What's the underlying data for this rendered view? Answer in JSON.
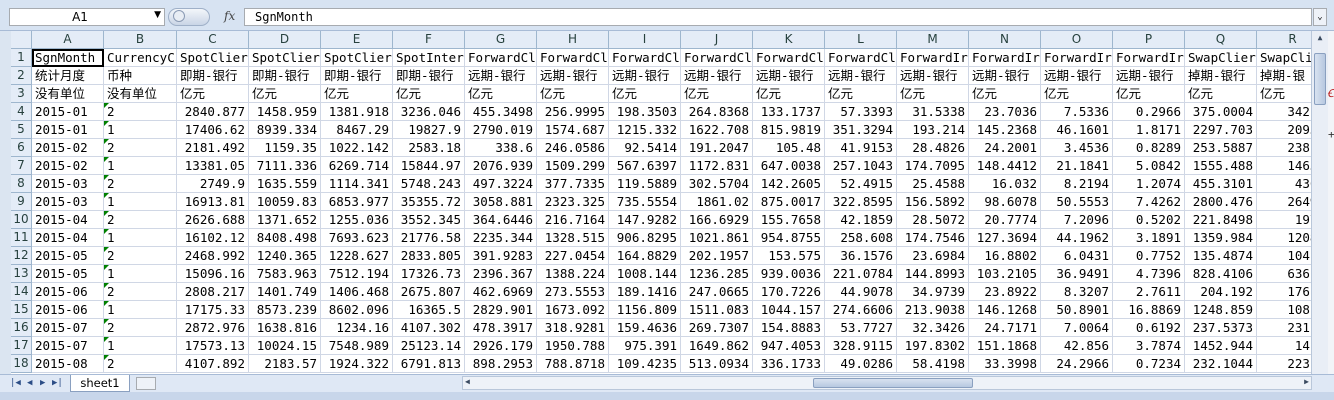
{
  "formula_bar": {
    "name_box": "A1",
    "fx_label": "fx",
    "formula": "SgnMonth"
  },
  "sheet": {
    "columns": [
      "A",
      "B",
      "C",
      "D",
      "E",
      "F",
      "G",
      "H",
      "I",
      "J",
      "K",
      "L",
      "M",
      "N",
      "O",
      "P",
      "Q",
      "R"
    ],
    "rows": [
      {
        "n": "1",
        "cells": [
          "SgnMonth",
          "CurrencyC",
          "SpotClier",
          "SpotClier",
          "SpotClier",
          "SpotInter",
          "ForwardCl",
          "ForwardCl",
          "ForwardCl",
          "ForwardCl",
          "ForwardCl",
          "ForwardCl",
          "ForwardIr",
          "ForwardIr",
          "ForwardIr",
          "ForwardIr",
          "SwapClier",
          "SwapCli"
        ]
      },
      {
        "n": "2",
        "cells": [
          "统计月度",
          "币种",
          "即期-银行",
          "即期-银行",
          "即期-银行",
          "即期-银行",
          "远期-银行",
          "远期-银行",
          "远期-银行",
          "远期-银行",
          "远期-银行",
          "远期-银行",
          "远期-银行",
          "远期-银行",
          "远期-银行",
          "远期-银行",
          "掉期-银行",
          "掉期-银"
        ]
      },
      {
        "n": "3",
        "cells": [
          "没有单位",
          "没有单位",
          "亿元",
          "亿元",
          "亿元",
          "亿元",
          "亿元",
          "亿元",
          "亿元",
          "亿元",
          "亿元",
          "亿元",
          "亿元",
          "亿元",
          "亿元",
          "亿元",
          "亿元",
          "亿元"
        ]
      },
      {
        "n": "4",
        "cells": [
          "2015-01",
          "2",
          "2840.877",
          "1458.959",
          "1381.918",
          "3236.046",
          "455.3498",
          "256.9995",
          "198.3503",
          "264.8368",
          "133.1737",
          "57.3393",
          "31.5338",
          "23.7036",
          "7.5336",
          "0.2966",
          "375.0004",
          "342.0"
        ]
      },
      {
        "n": "5",
        "cells": [
          "2015-01",
          "1",
          "17406.62",
          "8939.334",
          "8467.29",
          "19827.9",
          "2790.019",
          "1574.687",
          "1215.332",
          "1622.708",
          "815.9819",
          "351.3294",
          "193.214",
          "145.2368",
          "46.1601",
          "1.8171",
          "2297.703",
          "2095."
        ]
      },
      {
        "n": "6",
        "cells": [
          "2015-02",
          "2",
          "2181.492",
          "1159.35",
          "1022.142",
          "2583.18",
          "338.6",
          "246.0586",
          "92.5414",
          "191.2047",
          "105.48",
          "41.9153",
          "28.4826",
          "24.2001",
          "3.4536",
          "0.8289",
          "253.5887",
          "238.8"
        ]
      },
      {
        "n": "7",
        "cells": [
          "2015-02",
          "1",
          "13381.05",
          "7111.336",
          "6269.714",
          "15844.97",
          "2076.939",
          "1509.299",
          "567.6397",
          "1172.831",
          "647.0038",
          "257.1043",
          "174.7095",
          "148.4412",
          "21.1841",
          "5.0842",
          "1555.488",
          "1465."
        ]
      },
      {
        "n": "8",
        "cells": [
          "2015-03",
          "2",
          "2749.9",
          "1635.559",
          "1114.341",
          "5748.243",
          "497.3224",
          "377.7335",
          "119.5889",
          "302.5704",
          "142.2605",
          "52.4915",
          "25.4588",
          "16.032",
          "8.2194",
          "1.2074",
          "455.3101",
          "430."
        ]
      },
      {
        "n": "9",
        "cells": [
          "2015-03",
          "1",
          "16913.81",
          "10059.83",
          "6853.977",
          "35355.72",
          "3058.881",
          "2323.325",
          "735.5554",
          "1861.02",
          "875.0017",
          "322.8595",
          "156.5892",
          "98.6078",
          "50.5553",
          "7.4262",
          "2800.476",
          "2649."
        ]
      },
      {
        "n": "10",
        "cells": [
          "2015-04",
          "2",
          "2626.688",
          "1371.652",
          "1255.036",
          "3552.345",
          "364.6446",
          "216.7164",
          "147.9282",
          "166.6929",
          "155.7658",
          "42.1859",
          "28.5072",
          "20.7774",
          "7.2096",
          "0.5202",
          "221.8498",
          "197."
        ]
      },
      {
        "n": "11",
        "cells": [
          "2015-04",
          "1",
          "16102.12",
          "8408.498",
          "7693.623",
          "21776.58",
          "2235.344",
          "1328.515",
          "906.8295",
          "1021.861",
          "954.8755",
          "258.608",
          "174.7546",
          "127.3694",
          "44.1962",
          "3.1891",
          "1359.984",
          "1208."
        ]
      },
      {
        "n": "12",
        "cells": [
          "2015-05",
          "2",
          "2468.992",
          "1240.365",
          "1228.627",
          "2833.805",
          "391.9283",
          "227.0454",
          "164.8829",
          "202.1957",
          "153.575",
          "36.1576",
          "23.6984",
          "16.8802",
          "6.0431",
          "0.7752",
          "135.4874",
          "104.0"
        ]
      },
      {
        "n": "13",
        "cells": [
          "2015-05",
          "1",
          "15096.16",
          "7583.963",
          "7512.194",
          "17326.73",
          "2396.367",
          "1388.224",
          "1008.144",
          "1236.285",
          "939.0036",
          "221.0784",
          "144.8993",
          "103.2105",
          "36.9491",
          "4.7396",
          "828.4106",
          "636.1"
        ]
      },
      {
        "n": "14",
        "cells": [
          "2015-06",
          "2",
          "2808.217",
          "1401.749",
          "1406.468",
          "2675.807",
          "462.6969",
          "273.5553",
          "189.1416",
          "247.0665",
          "170.7226",
          "44.9078",
          "34.9739",
          "23.8922",
          "8.3207",
          "2.7611",
          "204.192",
          "176.8"
        ]
      },
      {
        "n": "15",
        "cells": [
          "2015-06",
          "1",
          "17175.33",
          "8573.239",
          "8602.096",
          "16365.5",
          "2829.901",
          "1673.092",
          "1156.809",
          "1511.083",
          "1044.157",
          "274.6606",
          "213.9038",
          "146.1268",
          "50.8901",
          "16.8869",
          "1248.859",
          "1081."
        ]
      },
      {
        "n": "16",
        "cells": [
          "2015-07",
          "2",
          "2872.976",
          "1638.816",
          "1234.16",
          "4107.302",
          "478.3917",
          "318.9281",
          "159.4636",
          "269.7307",
          "154.8883",
          "53.7727",
          "32.3426",
          "24.7171",
          "7.0064",
          "0.6192",
          "237.5373",
          "231.1"
        ]
      },
      {
        "n": "17",
        "cells": [
          "2015-07",
          "1",
          "17573.13",
          "10024.15",
          "7548.989",
          "25123.14",
          "2926.179",
          "1950.788",
          "975.391",
          "1649.862",
          "947.4053",
          "328.9115",
          "197.8302",
          "151.1868",
          "42.856",
          "3.7874",
          "1452.944",
          "1413"
        ]
      },
      {
        "n": "18",
        "cells": [
          "2015-08",
          "2",
          "4107.892",
          "2183.57",
          "1924.322",
          "6791.813",
          "898.2953",
          "788.8718",
          "109.4235",
          "513.0934",
          "336.1733",
          "49.0286",
          "58.4198",
          "33.3998",
          "24.2966",
          "0.7234",
          "232.1044",
          "223.0"
        ]
      }
    ]
  },
  "tabs": {
    "sheet1": "sheet1"
  },
  "colors": {
    "header_bg": "#e4ecf7",
    "grid_line": "#d0d7e5",
    "error_triangle": "#008000"
  }
}
